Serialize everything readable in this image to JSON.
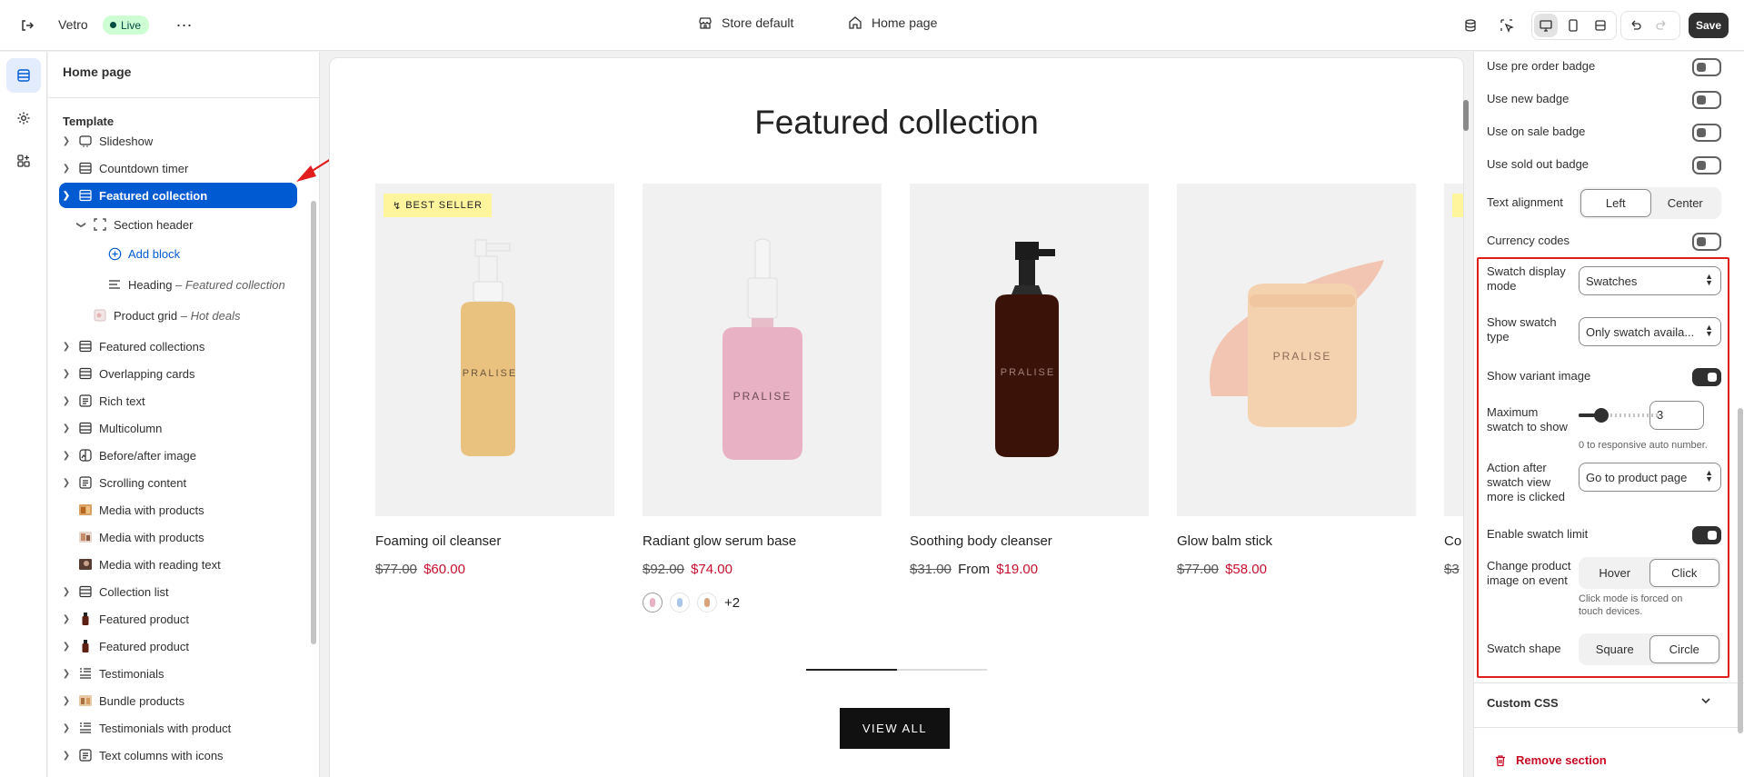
{
  "topbar": {
    "store_name": "Vetro",
    "status": "Live",
    "theme_selector": "Store default",
    "page_selector": "Home page",
    "save_label": "Save"
  },
  "sidebar": {
    "title": "Home page",
    "template_label": "Template",
    "items": [
      {
        "label": "Slideshow"
      },
      {
        "label": "Countdown timer"
      },
      {
        "label": "Featured collection"
      },
      {
        "label": "Section header"
      },
      {
        "label": "Add block"
      },
      {
        "label": "Heading",
        "sub": "Featured collection"
      },
      {
        "label": "Product grid",
        "sub": "Hot deals"
      },
      {
        "label": "Featured collections"
      },
      {
        "label": "Overlapping cards"
      },
      {
        "label": "Rich text"
      },
      {
        "label": "Multicolumn"
      },
      {
        "label": "Before/after image"
      },
      {
        "label": "Scrolling content"
      },
      {
        "label": "Media with products"
      },
      {
        "label": "Media with products"
      },
      {
        "label": "Media with reading text"
      },
      {
        "label": "Collection list"
      },
      {
        "label": "Featured product"
      },
      {
        "label": "Featured product"
      },
      {
        "label": "Testimonials"
      },
      {
        "label": "Bundle products"
      },
      {
        "label": "Testimonials with product"
      },
      {
        "label": "Text columns with icons"
      }
    ]
  },
  "canvas": {
    "heading": "Featured collection",
    "badge": "BEST SELLER",
    "brand_text": "PRALISE",
    "view_all": "VIEW ALL",
    "products": [
      {
        "title": "Foaming oil cleanser",
        "compare": "$77.00",
        "from": "",
        "price": "$60.00"
      },
      {
        "title": "Radiant glow serum base",
        "compare": "$92.00",
        "from": "",
        "price": "$74.00",
        "swatch_more": "+2"
      },
      {
        "title": "Soothing body cleanser",
        "compare": "$31.00",
        "from": "From",
        "price": "$19.00"
      },
      {
        "title": "Glow balm stick",
        "compare": "$77.00",
        "from": "",
        "price": "$58.00"
      },
      {
        "title": "Co",
        "compare": "$3"
      }
    ]
  },
  "settings": {
    "pre_order_badge": "Use pre order badge",
    "new_badge": "Use new badge",
    "on_sale_badge": "Use on sale badge",
    "sold_out_badge": "Use sold out badge",
    "text_alignment": {
      "label": "Text alignment",
      "options": [
        "Left",
        "Center"
      ],
      "selected": "Left"
    },
    "currency_codes": "Currency codes",
    "swatch_display_mode": {
      "label": "Swatch display mode",
      "value": "Swatches"
    },
    "show_swatch_type": {
      "label": "Show swatch type",
      "value": "Only swatch availa..."
    },
    "show_variant_image": {
      "label": "Show variant image",
      "on": true
    },
    "max_swatch": {
      "label": "Maximum swatch to show",
      "value": "3",
      "help": "0 to responsive auto number.",
      "slider_fraction": 0.3
    },
    "action_after": {
      "label": "Action after swatch view more is clicked",
      "value": "Go to product page"
    },
    "enable_swatch_limit": {
      "label": "Enable swatch limit",
      "on": true
    },
    "change_image": {
      "label": "Change product image on event",
      "options": [
        "Hover",
        "Click"
      ],
      "selected": "Click",
      "help": "Click mode is forced on touch devices."
    },
    "swatch_shape": {
      "label": "Swatch shape",
      "options": [
        "Square",
        "Circle"
      ],
      "selected": "Circle"
    },
    "custom_css": "Custom CSS",
    "remove_section": "Remove section"
  },
  "colors": {
    "accent": "#005bd3",
    "highlight": "#e11d1d",
    "sale": "#c8102e",
    "badge": "#fff59d"
  }
}
